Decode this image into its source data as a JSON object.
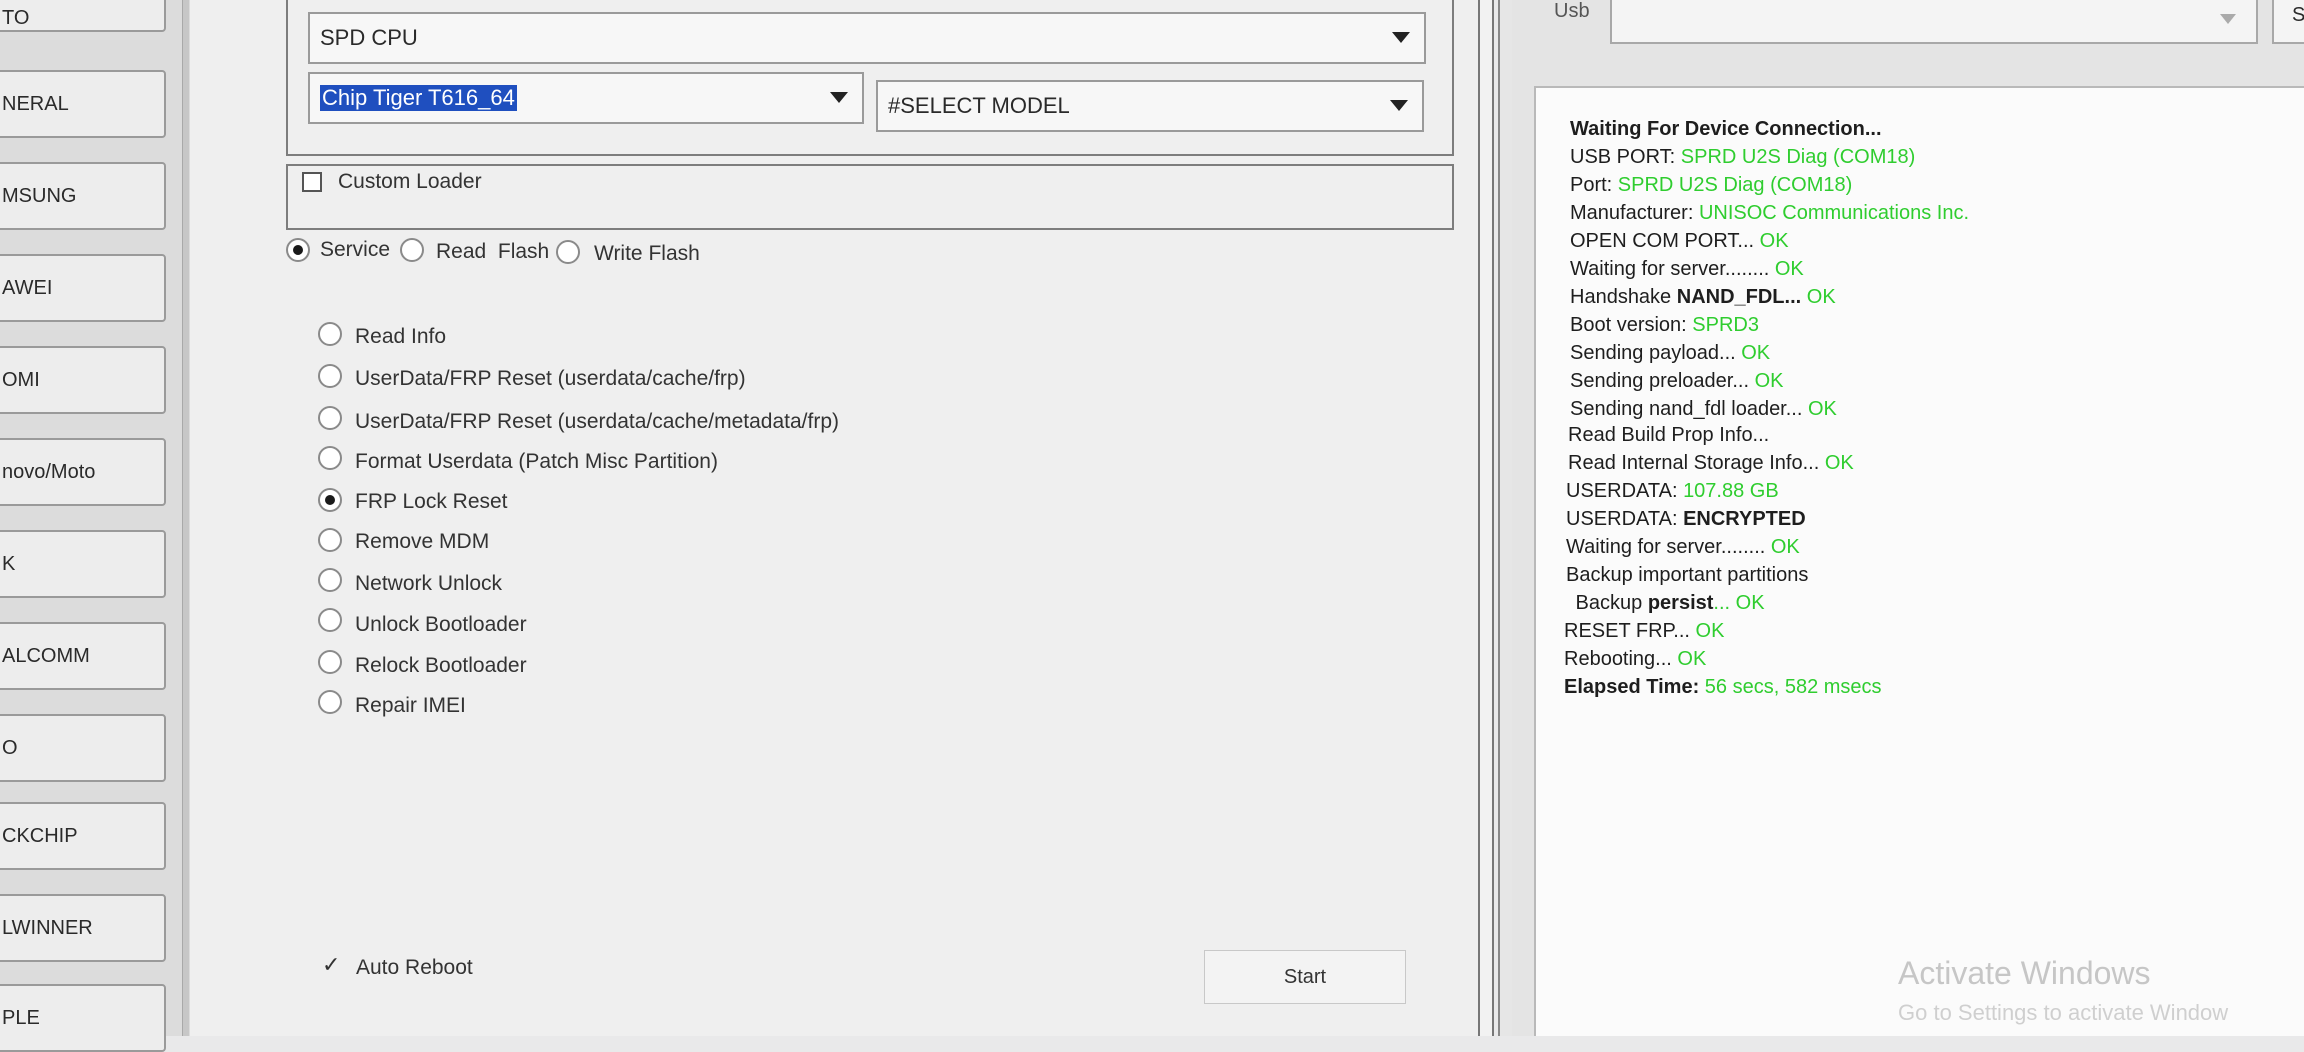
{
  "sidebar": {
    "items": [
      {
        "label": "TO"
      },
      {
        "label": "NERAL"
      },
      {
        "label": "MSUNG"
      },
      {
        "label": "AWEI"
      },
      {
        "label": "OMI"
      },
      {
        "label": "novo/Moto"
      },
      {
        "label": "K"
      },
      {
        "label": "ALCOMM"
      },
      {
        "label": "O"
      },
      {
        "label": "CKCHIP"
      },
      {
        "label": "LWINNER"
      },
      {
        "label": "PLE"
      }
    ]
  },
  "config": {
    "platform_value": "SPD CPU",
    "chip_value": "Chip Tiger T616_64",
    "model_value": "#SELECT MODEL",
    "custom_loader_label": "Custom Loader"
  },
  "modes": [
    {
      "label": "Service",
      "checked": true
    },
    {
      "label": "Read  Flash",
      "checked": false
    },
    {
      "label": "Write Flash",
      "checked": false
    }
  ],
  "operations": [
    {
      "label": "Read Info",
      "checked": false
    },
    {
      "label": "UserData/FRP Reset (userdata/cache/frp)",
      "checked": false
    },
    {
      "label": "UserData/FRP Reset (userdata/cache/metadata/frp)",
      "checked": false
    },
    {
      "label": "Format Userdata (Patch Misc Partition)",
      "checked": false
    },
    {
      "label": "FRP Lock Reset",
      "checked": true
    },
    {
      "label": "Remove MDM",
      "checked": false
    },
    {
      "label": "Network Unlock",
      "checked": false
    },
    {
      "label": "Unlock Bootloader",
      "checked": false
    },
    {
      "label": "Relock Bootloader",
      "checked": false
    },
    {
      "label": "Repair IMEI",
      "checked": false
    }
  ],
  "auto_reboot": {
    "label": "Auto Reboot",
    "checked": true
  },
  "start_label": "Start",
  "usb": {
    "label": "Usb",
    "value": "",
    "side_button": "S"
  },
  "log": [
    {
      "a": "Waiting For Device Connection...",
      "ab": true,
      "b": ""
    },
    {
      "a": "USB PORT: ",
      "b": "SPRD U2S Diag (COM18)"
    },
    {
      "a": "Port: ",
      "b": "SPRD U2S Diag (COM18)"
    },
    {
      "a": "Manufacturer: ",
      "b": "UNISOC Communications Inc."
    },
    {
      "a": "OPEN COM PORT... ",
      "b": "OK"
    },
    {
      "a": "Waiting for server........ ",
      "b": "OK"
    },
    {
      "a": "Handshake ",
      "m": "NAND_FDL...",
      "b": " OK"
    },
    {
      "a": "Boot version: ",
      "b": "SPRD3"
    },
    {
      "a": "Sending payload... ",
      "b": "OK"
    },
    {
      "a": "Sending preloader... ",
      "b": "OK"
    },
    {
      "a": "Sending nand_fdl loader... ",
      "b": "OK"
    },
    {
      "a": "Read Build Prop Info...",
      "b": ""
    },
    {
      "a": "Read Internal Storage Info... ",
      "b": "OK"
    },
    {
      "a": "USERDATA: ",
      "b": "107.88 GB"
    },
    {
      "a": "USERDATA: ",
      "m": "ENCRYPTED",
      "b": ""
    },
    {
      "a": "Waiting for server........ ",
      "b": "OK"
    },
    {
      "a": "Backup important partitions",
      "b": ""
    },
    {
      "a": " Backup ",
      "m": "persist",
      "b": "... OK"
    },
    {
      "a": "RESET FRP... ",
      "b": "OK"
    },
    {
      "a": "Rebooting... ",
      "b": "OK"
    },
    {
      "a": "Elapsed Time: ",
      "ab": true,
      "b": "56 secs, 582 msecs"
    }
  ],
  "watermark": {
    "line1": "Activate Windows",
    "line2": "Go to Settings to activate Window"
  },
  "colors": {
    "ok_green": "#2fcd2f",
    "selection_blue": "#1f4fbf"
  }
}
